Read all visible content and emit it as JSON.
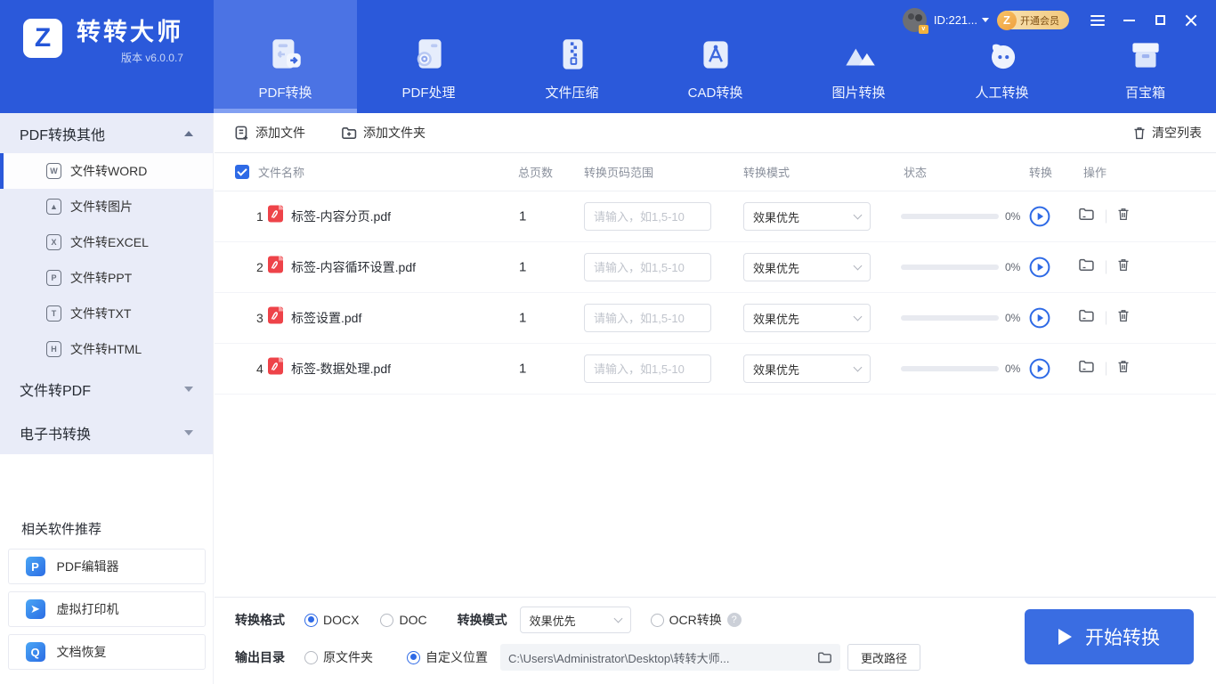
{
  "colors": {
    "header_blue": "#2b59da",
    "active_tab_blue": "#4b73e4",
    "accent_blue": "#2e6ae6",
    "sidebar_bg": "#e9ecf8",
    "pdf_red": "#ee4349",
    "vip_gold": "#f2c87c",
    "start_button_blue": "#3a6de2"
  },
  "brand": {
    "logo_glyph": "Z",
    "name": "转转大师",
    "version": "版本 v6.0.0.7"
  },
  "user": {
    "id_text": "ID:221...",
    "vip_logo_glyph": "Z",
    "vip_label": "开通会员"
  },
  "top_nav": {
    "items": [
      {
        "label": "PDF转换",
        "icon": "pdf-convert-icon",
        "active": true
      },
      {
        "label": "PDF处理",
        "icon": "pdf-process-icon",
        "active": false
      },
      {
        "label": "文件压缩",
        "icon": "file-compress-icon",
        "active": false
      },
      {
        "label": "CAD转换",
        "icon": "cad-convert-icon",
        "active": false
      },
      {
        "label": "图片转换",
        "icon": "image-convert-icon",
        "active": false
      },
      {
        "label": "人工转换",
        "icon": "manual-convert-icon",
        "active": false
      },
      {
        "label": "百宝箱",
        "icon": "toolbox-icon",
        "active": false
      }
    ]
  },
  "sidebar": {
    "sections": [
      {
        "label": "PDF转换其他",
        "expanded": true
      },
      {
        "label": "文件转PDF",
        "expanded": false
      },
      {
        "label": "电子书转换",
        "expanded": false
      }
    ],
    "items": [
      {
        "label": "文件转WORD",
        "glyph": "W",
        "active": true
      },
      {
        "label": "文件转图片",
        "glyph": "▲",
        "active": false
      },
      {
        "label": "文件转EXCEL",
        "glyph": "X",
        "active": false
      },
      {
        "label": "文件转PPT",
        "glyph": "P",
        "active": false
      },
      {
        "label": "文件转TXT",
        "glyph": "T",
        "active": false
      },
      {
        "label": "文件转HTML",
        "glyph": "H",
        "active": false
      }
    ],
    "recommend": {
      "title": "相关软件推荐",
      "items": [
        {
          "label": "PDF编辑器",
          "glyph": "P"
        },
        {
          "label": "虚拟打印机",
          "glyph": "➤"
        },
        {
          "label": "文档恢复",
          "glyph": "Q"
        }
      ]
    }
  },
  "toolbar": {
    "add_file": "添加文件",
    "add_folder": "添加文件夹",
    "clear_list": "清空列表"
  },
  "table": {
    "headers": {
      "name": "文件名称",
      "pages": "总页数",
      "range": "转换页码范围",
      "mode": "转换模式",
      "status": "状态",
      "convert": "转换",
      "actions": "操作"
    },
    "range_placeholder": "请输入，如1,5-10",
    "mode_value": "效果优先",
    "rows": [
      {
        "index": "1",
        "name": "标签-内容分页.pdf",
        "pages": "1",
        "progress_pct": "0%"
      },
      {
        "index": "2",
        "name": "标签-内容循环设置.pdf",
        "pages": "1",
        "progress_pct": "0%"
      },
      {
        "index": "3",
        "name": "标签设置.pdf",
        "pages": "1",
        "progress_pct": "0%"
      },
      {
        "index": "4",
        "name": "标签-数据处理.pdf",
        "pages": "1",
        "progress_pct": "0%"
      }
    ]
  },
  "footer": {
    "format_label": "转换格式",
    "format_docx": "DOCX",
    "format_doc": "DOC",
    "format_selected": "DOCX",
    "mode_label": "转换模式",
    "mode_value": "效果优先",
    "ocr_label": "OCR转换",
    "output_label": "输出目录",
    "output_source": "原文件夹",
    "output_custom": "自定义位置",
    "output_selected": "自定义位置",
    "path_value": "C:\\Users\\Administrator\\Desktop\\转转大师...",
    "change_path_label": "更改路径",
    "start_label": "开始转换"
  }
}
